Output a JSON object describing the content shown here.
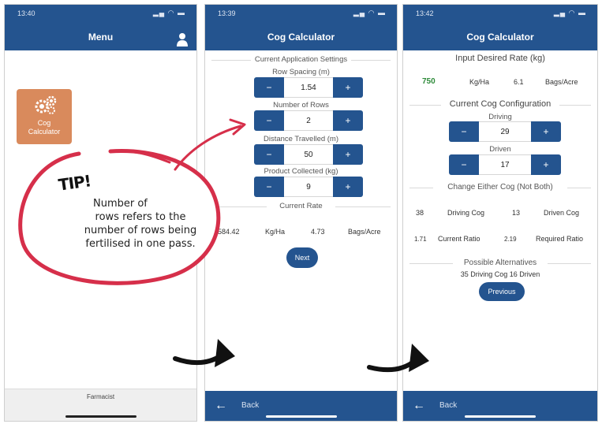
{
  "screens": {
    "menu": {
      "time": "13:40",
      "title": "Menu",
      "tile_label_line1": "Cog",
      "tile_label_line2": "Calculator",
      "footer": "Farmacist"
    },
    "cog1": {
      "time": "13:39",
      "title": "Cog Calculator",
      "section_current": "Current Application Settings",
      "row_spacing_label": "Row Spacing (m)",
      "row_spacing_value": "1.54",
      "num_rows_label": "Number of Rows",
      "num_rows_value": "2",
      "distance_label": "Distance Travelled (m)",
      "distance_value": "50",
      "product_label": "Product Collected (kg)",
      "product_value": "9",
      "current_rate_label": "Current Rate",
      "rate_kgha": "584.42",
      "kgha_unit": "Kg/Ha",
      "rate_bags": "4.73",
      "bags_unit": "Bags/Acre",
      "next": "Next",
      "back": "Back"
    },
    "cog2": {
      "time": "13:42",
      "title": "Cog Calculator",
      "input_rate_label": "Input Desired Rate (kg)",
      "desired_kgha": "750",
      "kgha_unit": "Kg/Ha",
      "desired_bags": "6.1",
      "bags_unit": "Bags/Acre",
      "config_label": "Current Cog Configuration",
      "driving_label": "Driving",
      "driving_value": "29",
      "driven_label": "Driven",
      "driven_value": "17",
      "change_label": "Change Either Cog (Not Both)",
      "driving_cog_val": "38",
      "driving_cog_label": "Driving Cog",
      "driven_cog_val": "13",
      "driven_cog_label": "Driven Cog",
      "current_ratio_val": "1.71",
      "current_ratio_label": "Current Ratio",
      "required_ratio_val": "2.19",
      "required_ratio_label": "Required Ratio",
      "alternatives_label": "Possible Alternatives",
      "alt_line": "35 Driving Cog 16 Driven",
      "previous": "Previous",
      "back": "Back"
    }
  },
  "buttons": {
    "minus": "−",
    "plus": "+"
  },
  "tip": {
    "heading": "TIP!",
    "line1": "Number of",
    "line2": "rows refers to the",
    "line3": "number of rows being",
    "line4": "fertilised in one pass."
  },
  "colors": {
    "navy": "#24548f",
    "tile": "#d98a5c",
    "accent_red": "#d62f4a",
    "green": "#5ea35b"
  }
}
